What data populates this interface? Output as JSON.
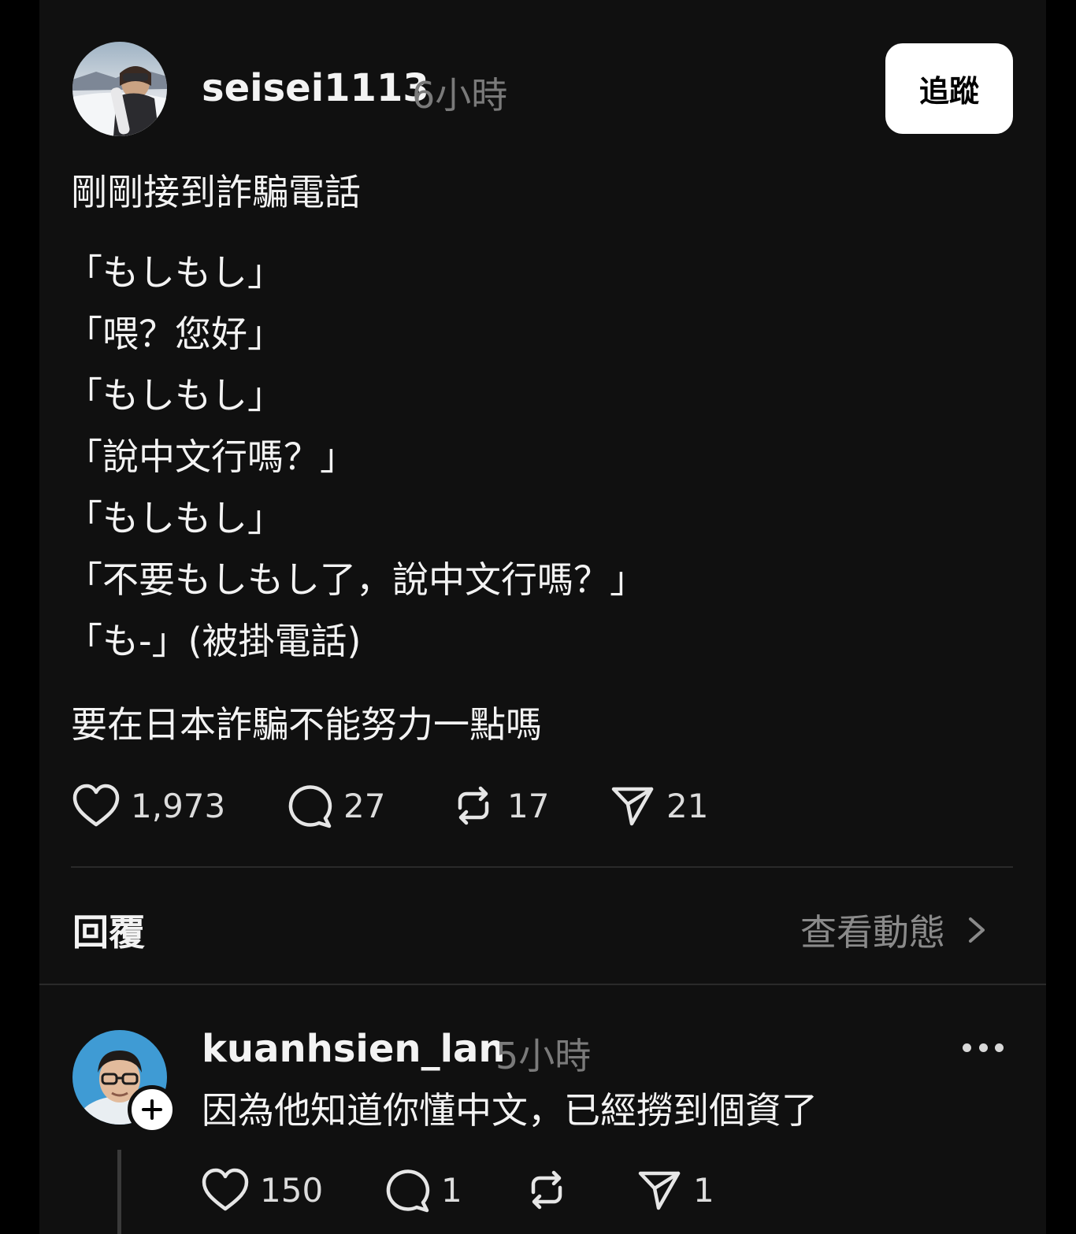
{
  "post": {
    "username": "seisei1113",
    "time": "6小時",
    "follow_label": "追蹤",
    "lines": [
      "剛剛接到詐騙電話",
      "「もしもし」",
      "「喂？您好」",
      "「もしもし」",
      "「說中文行嗎？」",
      "「もしもし」",
      "「不要もしもし了，說中文行嗎？」",
      "「も-」(被掛電話)",
      "要在日本詐騙不能努力一點嗎"
    ],
    "likes": "1,973",
    "comments": "27",
    "reposts": "17",
    "shares": "21"
  },
  "replies_section": {
    "title": "回覆",
    "view_activity": "查看動態"
  },
  "reply": {
    "username": "kuanhsien_lan",
    "time": "5小時",
    "text": "因為他知道你懂中文，已經撈到個資了",
    "likes": "150",
    "comments": "1",
    "shares": "1"
  },
  "icons": {
    "like": "heart-icon",
    "comment": "comment-icon",
    "repost": "repost-icon",
    "share": "send-icon",
    "chevron": "chevron-right-icon",
    "more": "more-icon",
    "follow_plus": "plus-icon"
  },
  "colors": {
    "background": "#101010",
    "outer": "#000000",
    "text": "#f3f3f3",
    "muted": "#7a7a7a",
    "follow_button": "#ffffff"
  }
}
